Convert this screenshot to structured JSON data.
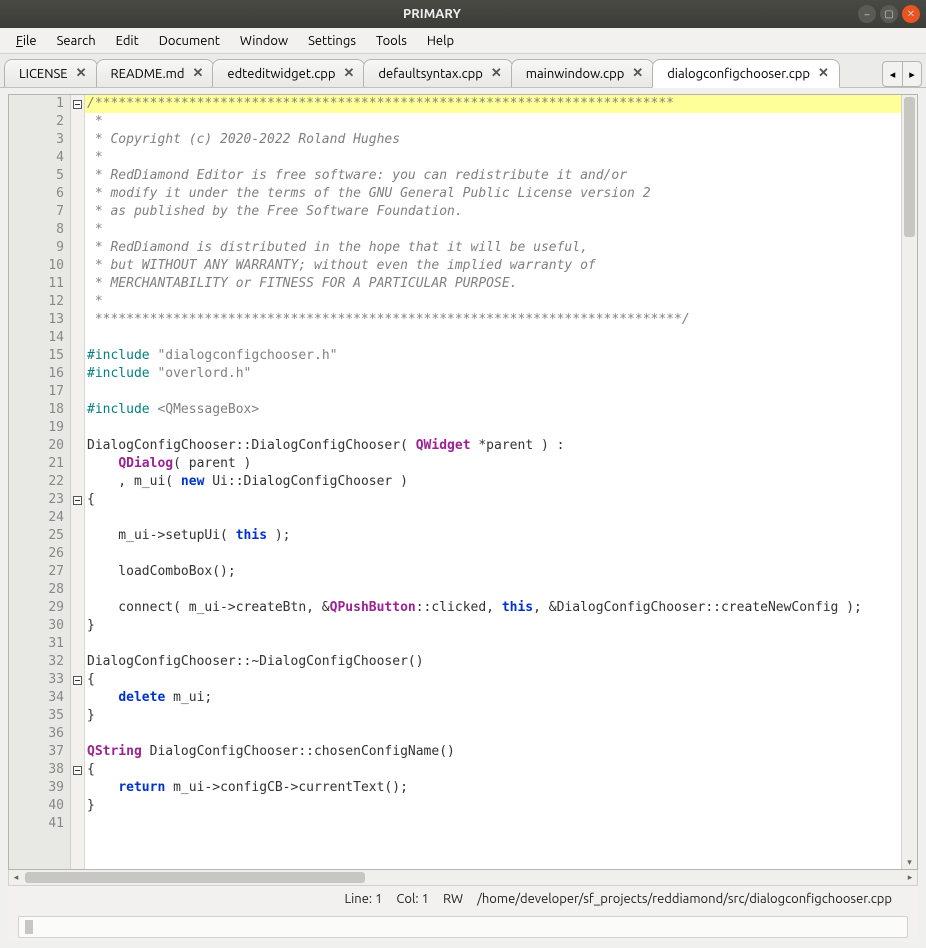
{
  "window": {
    "title": "PRIMARY"
  },
  "menu": {
    "items": [
      {
        "label": "File",
        "u": "F"
      },
      {
        "label": "Search",
        "u": ""
      },
      {
        "label": "Edit",
        "u": ""
      },
      {
        "label": "Document",
        "u": ""
      },
      {
        "label": "Window",
        "u": ""
      },
      {
        "label": "Settings",
        "u": ""
      },
      {
        "label": "Tools",
        "u": ""
      },
      {
        "label": "Help",
        "u": ""
      }
    ]
  },
  "tabs": {
    "items": [
      {
        "label": "LICENSE",
        "active": false
      },
      {
        "label": "README.md",
        "active": false
      },
      {
        "label": "edteditwidget.cpp",
        "active": false
      },
      {
        "label": "defaultsyntax.cpp",
        "active": false
      },
      {
        "label": "mainwindow.cpp",
        "active": false
      },
      {
        "label": "dialogconfigchooser.cpp",
        "active": true
      }
    ]
  },
  "code": {
    "fold_lines": [
      1,
      23,
      33,
      38
    ],
    "lines": [
      {
        "n": 1,
        "hl": true,
        "segs": [
          [
            "c-comment",
            "/**************************************************************************"
          ]
        ]
      },
      {
        "n": 2,
        "segs": [
          [
            "c-comment",
            " *"
          ]
        ]
      },
      {
        "n": 3,
        "segs": [
          [
            "c-comment",
            " * Copyright (c) 2020-2022 Roland Hughes"
          ]
        ]
      },
      {
        "n": 4,
        "segs": [
          [
            "c-comment",
            " *"
          ]
        ]
      },
      {
        "n": 5,
        "segs": [
          [
            "c-comment",
            " * RedDiamond Editor is free software: you can redistribute it and/or"
          ]
        ]
      },
      {
        "n": 6,
        "segs": [
          [
            "c-comment",
            " * modify it under the terms of the GNU General Public License version 2"
          ]
        ]
      },
      {
        "n": 7,
        "segs": [
          [
            "c-comment",
            " * as published by the Free Software Foundation."
          ]
        ]
      },
      {
        "n": 8,
        "segs": [
          [
            "c-comment",
            " *"
          ]
        ]
      },
      {
        "n": 9,
        "segs": [
          [
            "c-comment",
            " * RedDiamond is distributed in the hope that it will be useful,"
          ]
        ]
      },
      {
        "n": 10,
        "segs": [
          [
            "c-comment",
            " * but WITHOUT ANY WARRANTY; without even the implied warranty of"
          ]
        ]
      },
      {
        "n": 11,
        "segs": [
          [
            "c-comment",
            " * MERCHANTABILITY or FITNESS FOR A PARTICULAR PURPOSE."
          ]
        ]
      },
      {
        "n": 12,
        "segs": [
          [
            "c-comment",
            " *"
          ]
        ]
      },
      {
        "n": 13,
        "segs": [
          [
            "c-comment",
            " ***************************************************************************/"
          ]
        ]
      },
      {
        "n": 14,
        "segs": [
          [
            "",
            ""
          ]
        ]
      },
      {
        "n": 15,
        "segs": [
          [
            "c-pre",
            "#include "
          ],
          [
            "c-str",
            "\"dialogconfigchooser.h\""
          ]
        ]
      },
      {
        "n": 16,
        "segs": [
          [
            "c-pre",
            "#include "
          ],
          [
            "c-str",
            "\"overlord.h\""
          ]
        ]
      },
      {
        "n": 17,
        "segs": [
          [
            "",
            ""
          ]
        ]
      },
      {
        "n": 18,
        "segs": [
          [
            "c-pre",
            "#include "
          ],
          [
            "c-str",
            "<QMessageBox>"
          ]
        ]
      },
      {
        "n": 19,
        "segs": [
          [
            "",
            ""
          ]
        ]
      },
      {
        "n": 20,
        "segs": [
          [
            "",
            "DialogConfigChooser::DialogConfigChooser( "
          ],
          [
            "c-type",
            "QWidget"
          ],
          [
            "",
            " *parent ) :"
          ]
        ]
      },
      {
        "n": 21,
        "segs": [
          [
            "",
            "    "
          ],
          [
            "c-type",
            "QDialog"
          ],
          [
            "",
            "( parent )"
          ]
        ]
      },
      {
        "n": 22,
        "segs": [
          [
            "",
            "    , m_ui( "
          ],
          [
            "c-kw",
            "new"
          ],
          [
            "",
            " Ui::DialogConfigChooser )"
          ]
        ]
      },
      {
        "n": 23,
        "segs": [
          [
            "",
            "{"
          ]
        ]
      },
      {
        "n": 24,
        "segs": [
          [
            "",
            ""
          ]
        ]
      },
      {
        "n": 25,
        "segs": [
          [
            "",
            "    m_ui->setupUi( "
          ],
          [
            "c-kw",
            "this"
          ],
          [
            "",
            " );"
          ]
        ]
      },
      {
        "n": 26,
        "segs": [
          [
            "",
            ""
          ]
        ]
      },
      {
        "n": 27,
        "segs": [
          [
            "",
            "    loadComboBox();"
          ]
        ]
      },
      {
        "n": 28,
        "segs": [
          [
            "",
            ""
          ]
        ]
      },
      {
        "n": 29,
        "segs": [
          [
            "",
            "    connect( m_ui->createBtn, &"
          ],
          [
            "c-qclass",
            "QPushButton"
          ],
          [
            "",
            "::clicked, "
          ],
          [
            "c-kw",
            "this"
          ],
          [
            "",
            ", &DialogConfigChooser::createNewConfig );"
          ]
        ]
      },
      {
        "n": 30,
        "segs": [
          [
            "",
            "}"
          ]
        ]
      },
      {
        "n": 31,
        "segs": [
          [
            "",
            ""
          ]
        ]
      },
      {
        "n": 32,
        "segs": [
          [
            "",
            "DialogConfigChooser::~DialogConfigChooser()"
          ]
        ]
      },
      {
        "n": 33,
        "segs": [
          [
            "",
            "{"
          ]
        ]
      },
      {
        "n": 34,
        "segs": [
          [
            "",
            "    "
          ],
          [
            "c-kw",
            "delete"
          ],
          [
            "",
            " m_ui;"
          ]
        ]
      },
      {
        "n": 35,
        "segs": [
          [
            "",
            "}"
          ]
        ]
      },
      {
        "n": 36,
        "segs": [
          [
            "",
            ""
          ]
        ]
      },
      {
        "n": 37,
        "segs": [
          [
            "c-type",
            "QString"
          ],
          [
            "",
            " DialogConfigChooser::chosenConfigName()"
          ]
        ]
      },
      {
        "n": 38,
        "segs": [
          [
            "",
            "{"
          ]
        ]
      },
      {
        "n": 39,
        "segs": [
          [
            "",
            "    "
          ],
          [
            "c-kw",
            "return"
          ],
          [
            "",
            " m_ui->configCB->currentText();"
          ]
        ]
      },
      {
        "n": 40,
        "segs": [
          [
            "",
            "}"
          ]
        ]
      },
      {
        "n": 41,
        "segs": [
          [
            "",
            ""
          ]
        ]
      }
    ]
  },
  "status": {
    "line": "Line: 1",
    "col": "Col: 1",
    "mode": "RW",
    "path": "/home/developer/sf_projects/reddiamond/src/dialogconfigchooser.cpp"
  }
}
